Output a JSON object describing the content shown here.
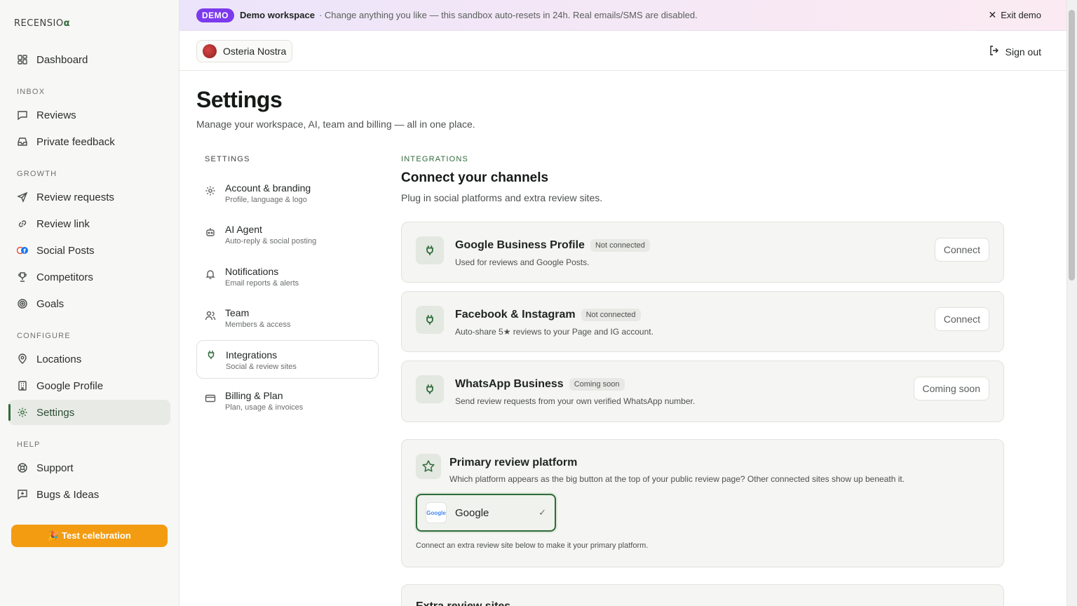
{
  "app": {
    "logo_text": "RECENSIO",
    "logo_mark": "α"
  },
  "sidebar": {
    "items": [
      {
        "label": "Dashboard",
        "icon": "dashboard-icon"
      },
      {
        "label": "Reviews",
        "icon": "chat-icon"
      },
      {
        "label": "Private feedback",
        "icon": "inbox-icon"
      },
      {
        "label": "Review requests",
        "icon": "send-icon"
      },
      {
        "label": "Review link",
        "icon": "link-icon"
      },
      {
        "label": "Social Posts",
        "icon": "social-icon"
      },
      {
        "label": "Competitors",
        "icon": "trophy-icon"
      },
      {
        "label": "Goals",
        "icon": "target-icon"
      },
      {
        "label": "Locations",
        "icon": "pin-icon"
      },
      {
        "label": "Google Profile",
        "icon": "building-icon"
      },
      {
        "label": "Settings",
        "icon": "gear-icon"
      },
      {
        "label": "Support",
        "icon": "lifebuoy-icon"
      },
      {
        "label": "Bugs & Ideas",
        "icon": "message-plus-icon"
      }
    ],
    "sections": {
      "inbox": "INBOX",
      "growth": "GROWTH",
      "configure": "CONFIGURE",
      "help": "HELP"
    },
    "celebrate_label": "🎉 Test celebration"
  },
  "banner": {
    "pill": "DEMO",
    "title": "Demo workspace",
    "message": "· Change anything you like — this sandbox auto-resets in 24h. Real emails/SMS are disabled.",
    "exit_label": "Exit demo"
  },
  "topbar": {
    "location": "Osteria Nostra",
    "signout_label": "Sign out"
  },
  "page": {
    "title": "Settings",
    "subtitle": "Manage your workspace, AI, team and billing — all in one place."
  },
  "settings_nav": {
    "title": "SETTINGS",
    "items": [
      {
        "title": "Account & branding",
        "desc": "Profile, language & logo"
      },
      {
        "title": "AI Agent",
        "desc": "Auto-reply & social posting"
      },
      {
        "title": "Notifications",
        "desc": "Email reports & alerts"
      },
      {
        "title": "Team",
        "desc": "Members & access"
      },
      {
        "title": "Integrations",
        "desc": "Social & review sites"
      },
      {
        "title": "Billing & Plan",
        "desc": "Plan, usage & invoices"
      }
    ]
  },
  "integrations": {
    "tag": "INTEGRATIONS",
    "title": "Connect your channels",
    "subtitle": "Plug in social platforms and extra review sites.",
    "cards": [
      {
        "name": "Google Business Profile",
        "badge": "Not connected",
        "desc": "Used for reviews and Google Posts.",
        "button": "Connect"
      },
      {
        "name": "Facebook & Instagram",
        "badge": "Not connected",
        "desc": "Auto-share 5★ reviews to your Page and IG account.",
        "button": "Connect"
      },
      {
        "name": "WhatsApp Business",
        "badge": "Coming soon",
        "desc": "Send review requests from your own verified WhatsApp number.",
        "button": "Coming soon"
      }
    ],
    "primary": {
      "title": "Primary review platform",
      "desc": "Which platform appears as the big button at the top of your public review page? Other connected sites show up beneath it.",
      "option": "Google",
      "option_logo": "Google",
      "note": "Connect an extra review site below to make it your primary platform."
    },
    "extra_title": "Extra review sites"
  }
}
